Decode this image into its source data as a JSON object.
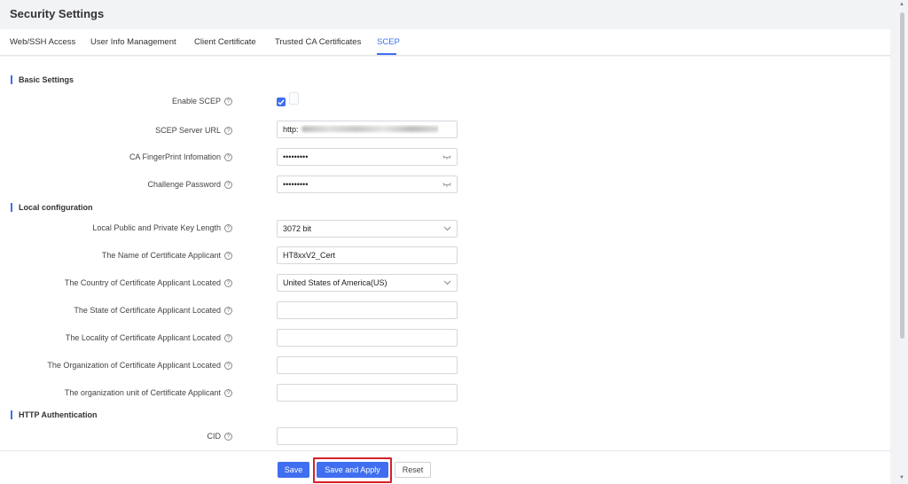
{
  "page": {
    "title": "Security Settings"
  },
  "tabs": [
    {
      "label": "Web/SSH Access"
    },
    {
      "label": "User Info Management"
    },
    {
      "label": "Client Certificate"
    },
    {
      "label": "Trusted CA Certificates"
    },
    {
      "label": "SCEP",
      "active": true
    }
  ],
  "sections": {
    "basic": "Basic Settings",
    "local": "Local configuration",
    "http": "HTTP Authentication"
  },
  "fields": {
    "enable_scep": {
      "label": "Enable SCEP",
      "checked": true
    },
    "server_url": {
      "label": "SCEP Server URL",
      "value": "http:"
    },
    "ca_fingerprint": {
      "label": "CA FingerPrint Infomation",
      "value": "•••••••••"
    },
    "challenge_password": {
      "label": "Challenge Password",
      "value": "•••••••••"
    },
    "key_length": {
      "label": "Local Public and Private Key Length",
      "value": "3072 bit"
    },
    "applicant_name": {
      "label": "The Name of Certificate Applicant",
      "value": "HT8xxV2_Cert"
    },
    "country": {
      "label": "The Country of Certificate Applicant Located",
      "value": "United States of America(US)"
    },
    "state": {
      "label": "The State of Certificate Applicant Located",
      "value": ""
    },
    "locality": {
      "label": "The Locality of Certificate Applicant Located",
      "value": ""
    },
    "organization": {
      "label": "The Organization of Certificate Applicant Located",
      "value": ""
    },
    "org_unit": {
      "label": "The organization unit of Certificate Applicant",
      "value": ""
    },
    "cid": {
      "label": "CID",
      "value": ""
    }
  },
  "help_glyph": "?",
  "footer": {
    "save": "Save",
    "save_apply": "Save and Apply",
    "reset": "Reset"
  },
  "colors": {
    "accent": "#3f6ff0",
    "highlight": "#d6202a"
  }
}
